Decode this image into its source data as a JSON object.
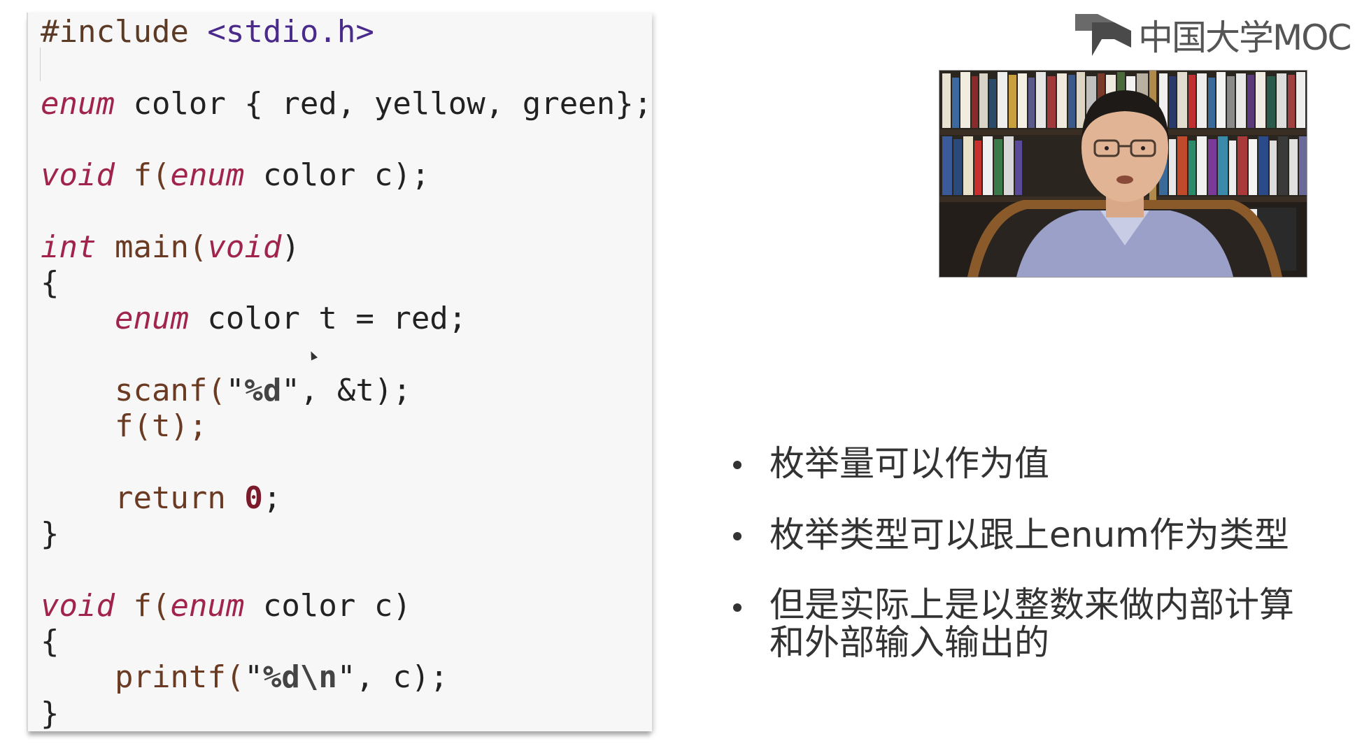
{
  "logo": {
    "text": "中国大学MOC"
  },
  "code": {
    "lines": [
      [
        {
          "t": "#include ",
          "c": "inc"
        },
        {
          "t": "<stdio.h>",
          "c": "hdr"
        }
      ],
      [],
      [
        {
          "t": "enum",
          "c": "kw"
        },
        {
          "t": " color { red, yellow, green};",
          "c": "plain"
        }
      ],
      [],
      [
        {
          "t": "void",
          "c": "kw"
        },
        {
          "t": " f(",
          "c": "fn"
        },
        {
          "t": "enum",
          "c": "kw"
        },
        {
          "t": " color c);",
          "c": "plain"
        }
      ],
      [],
      [
        {
          "t": "int",
          "c": "kw"
        },
        {
          "t": " main(",
          "c": "fn"
        },
        {
          "t": "void",
          "c": "kw"
        },
        {
          "t": ")",
          "c": "plain"
        }
      ],
      [
        {
          "t": "{",
          "c": "plain"
        }
      ],
      [
        {
          "t": "    ",
          "c": "plain"
        },
        {
          "t": "enum",
          "c": "kw"
        },
        {
          "t": " color t = red;",
          "c": "plain"
        }
      ],
      [],
      [
        {
          "t": "    scanf(",
          "c": "fn"
        },
        {
          "t": "\"",
          "c": "str"
        },
        {
          "t": "%d",
          "c": "fmt"
        },
        {
          "t": "\", &t);",
          "c": "str"
        }
      ],
      [
        {
          "t": "    f(t);",
          "c": "fn"
        }
      ],
      [],
      [
        {
          "t": "    return ",
          "c": "fn"
        },
        {
          "t": "0",
          "c": "num"
        },
        {
          "t": ";",
          "c": "plain"
        }
      ],
      [
        {
          "t": "}",
          "c": "plain"
        }
      ],
      [],
      [
        {
          "t": "void",
          "c": "kw"
        },
        {
          "t": " f(",
          "c": "fn"
        },
        {
          "t": "enum",
          "c": "kw"
        },
        {
          "t": " color c)",
          "c": "plain"
        }
      ],
      [
        {
          "t": "{",
          "c": "plain"
        }
      ],
      [
        {
          "t": "    printf(",
          "c": "fn"
        },
        {
          "t": "\"",
          "c": "str"
        },
        {
          "t": "%d\\n",
          "c": "fmt"
        },
        {
          "t": "\", c);",
          "c": "str"
        }
      ],
      [
        {
          "t": "}",
          "c": "plain"
        }
      ]
    ]
  },
  "bullets": [
    {
      "text": "枚举量可以作为值"
    },
    {
      "text": "枚举类型可以跟上enum作为类型"
    },
    {
      "text": "但是实际上是以整数来做内部计算\n和外部输入输出的"
    }
  ],
  "video": {
    "icon": "presenter-video-thumbnail"
  }
}
